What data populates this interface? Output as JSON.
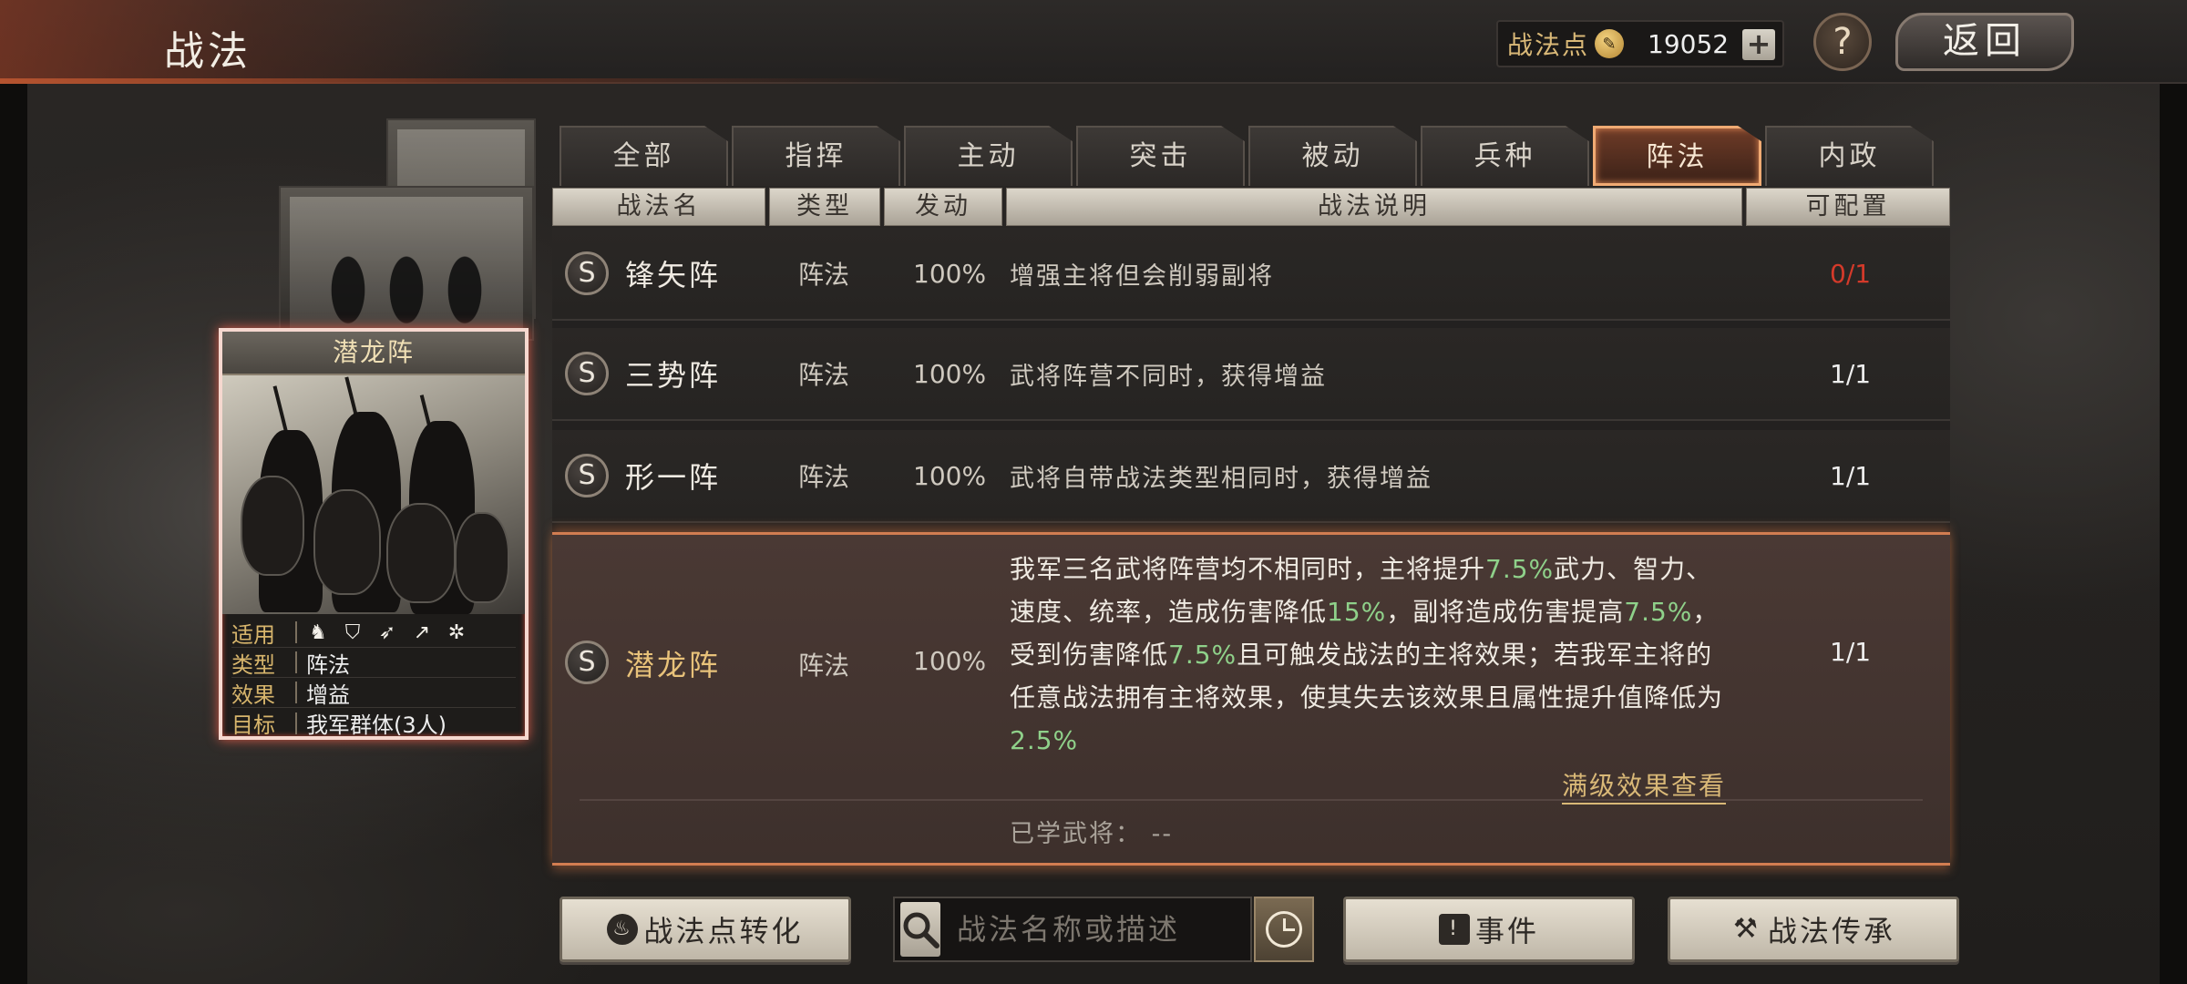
{
  "header": {
    "title": "战法",
    "points_label": "战法点",
    "points_value": "19052",
    "plus_label": "+",
    "help_label": "?",
    "back_label": "返回"
  },
  "card": {
    "title": "潜龙阵",
    "rows": [
      {
        "key": "适用",
        "value": ""
      },
      {
        "key": "类型",
        "value": "阵法"
      },
      {
        "key": "效果",
        "value": "增益"
      },
      {
        "key": "目标",
        "value": "我军群体(3人)"
      }
    ],
    "unit_icons": [
      "cavalry-icon",
      "shield-icon",
      "bow-icon",
      "spear-icon",
      "wheel-icon"
    ]
  },
  "tabs": [
    {
      "label": "全部",
      "active": false
    },
    {
      "label": "指挥",
      "active": false
    },
    {
      "label": "主动",
      "active": false
    },
    {
      "label": "突击",
      "active": false
    },
    {
      "label": "被动",
      "active": false
    },
    {
      "label": "兵种",
      "active": false
    },
    {
      "label": "阵法",
      "active": true
    },
    {
      "label": "内政",
      "active": false
    }
  ],
  "columns": [
    "战法名",
    "类型",
    "发动",
    "战法说明",
    "可配置"
  ],
  "rows": [
    {
      "badge": "S",
      "name": "锋矢阵",
      "type": "阵法",
      "rate": "100%",
      "desc": "增强主将但会削弱副将",
      "config": "0/1"
    },
    {
      "badge": "S",
      "name": "三势阵",
      "type": "阵法",
      "rate": "100%",
      "desc": "武将阵营不同时，获得增益",
      "config": "1/1"
    },
    {
      "badge": "S",
      "name": "形一阵",
      "type": "阵法",
      "rate": "100%",
      "desc": "武将自带战法类型相同时，获得增益",
      "config": "1/1"
    }
  ],
  "selected": {
    "badge": "S",
    "name": "潜龙阵",
    "type": "阵法",
    "rate": "100%",
    "config": "1/1",
    "desc_parts": {
      "p1": "我军三名武将阵营均不相同时，主将提升",
      "v1": "7.5%",
      "p2": "武力、智力、速度、统率，造成伤害降低",
      "v2": "15%",
      "p3": "，副将造成伤害提高",
      "v3": "7.5%",
      "p4": "，受到伤害降低",
      "v4": "7.5%",
      "p5": "且可触发战法的主将效果；若我军主将的任意战法拥有主将效果，使其失去该效果且属性提升值降低为",
      "v5": "2.5%"
    },
    "full_effect_link": "满级效果查看",
    "learned_label": "已学武将：  --"
  },
  "bottom": {
    "convert_label": "战法点转化",
    "search_placeholder": "战法名称或描述",
    "event_label": "事件",
    "inherit_label": "战法传承"
  },
  "colors": {
    "accent": "#d27d51",
    "highlight_value": "#8fd18a",
    "warning": "#d43a2a",
    "gold_text": "#d9b877"
  }
}
